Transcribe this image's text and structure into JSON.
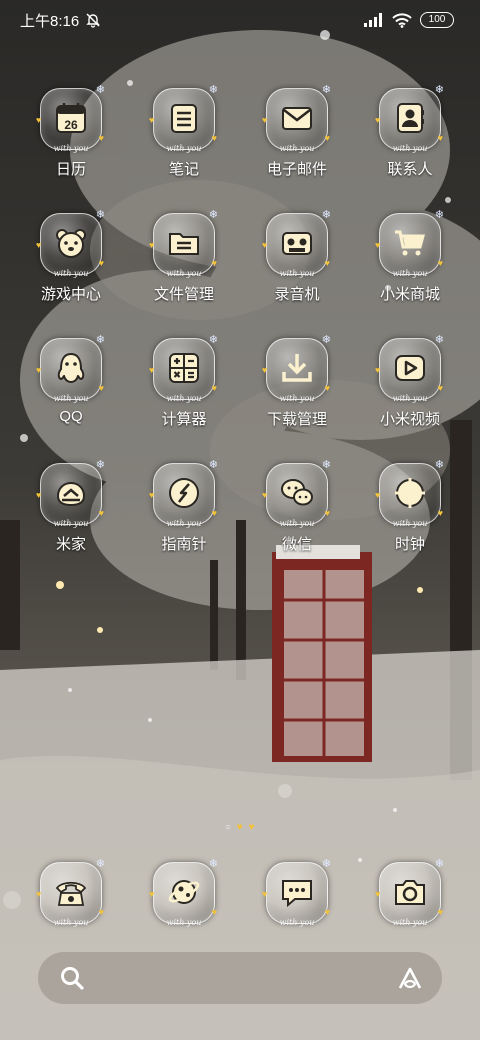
{
  "status_bar": {
    "time": "上午8:16",
    "battery": "100"
  },
  "apps": [
    {
      "label": "日历",
      "icon": "calendar-icon",
      "badge": "26"
    },
    {
      "label": "笔记",
      "icon": "notes-icon"
    },
    {
      "label": "电子邮件",
      "icon": "mail-icon"
    },
    {
      "label": "联系人",
      "icon": "contacts-icon"
    },
    {
      "label": "游戏中心",
      "icon": "bear-icon"
    },
    {
      "label": "文件管理",
      "icon": "folder-icon"
    },
    {
      "label": "录音机",
      "icon": "recorder-icon"
    },
    {
      "label": "小米商城",
      "icon": "cart-icon"
    },
    {
      "label": "QQ",
      "icon": "penguin-icon"
    },
    {
      "label": "计算器",
      "icon": "calculator-icon"
    },
    {
      "label": "下载管理",
      "icon": "download-icon"
    },
    {
      "label": "小米视频",
      "icon": "video-icon"
    },
    {
      "label": "米家",
      "icon": "home-icon"
    },
    {
      "label": "指南针",
      "icon": "compass-icon"
    },
    {
      "label": "微信",
      "icon": "wechat-icon"
    },
    {
      "label": "时钟",
      "icon": "clock-icon"
    }
  ],
  "dock": [
    {
      "icon": "phone-icon"
    },
    {
      "icon": "browser-icon"
    },
    {
      "icon": "message-icon"
    },
    {
      "icon": "camera-icon"
    }
  ],
  "tagline": "with you",
  "colors": {
    "accent": "#f2c23a",
    "icon_fill": "#fbf1cf",
    "icon_stroke": "#2a2622"
  }
}
